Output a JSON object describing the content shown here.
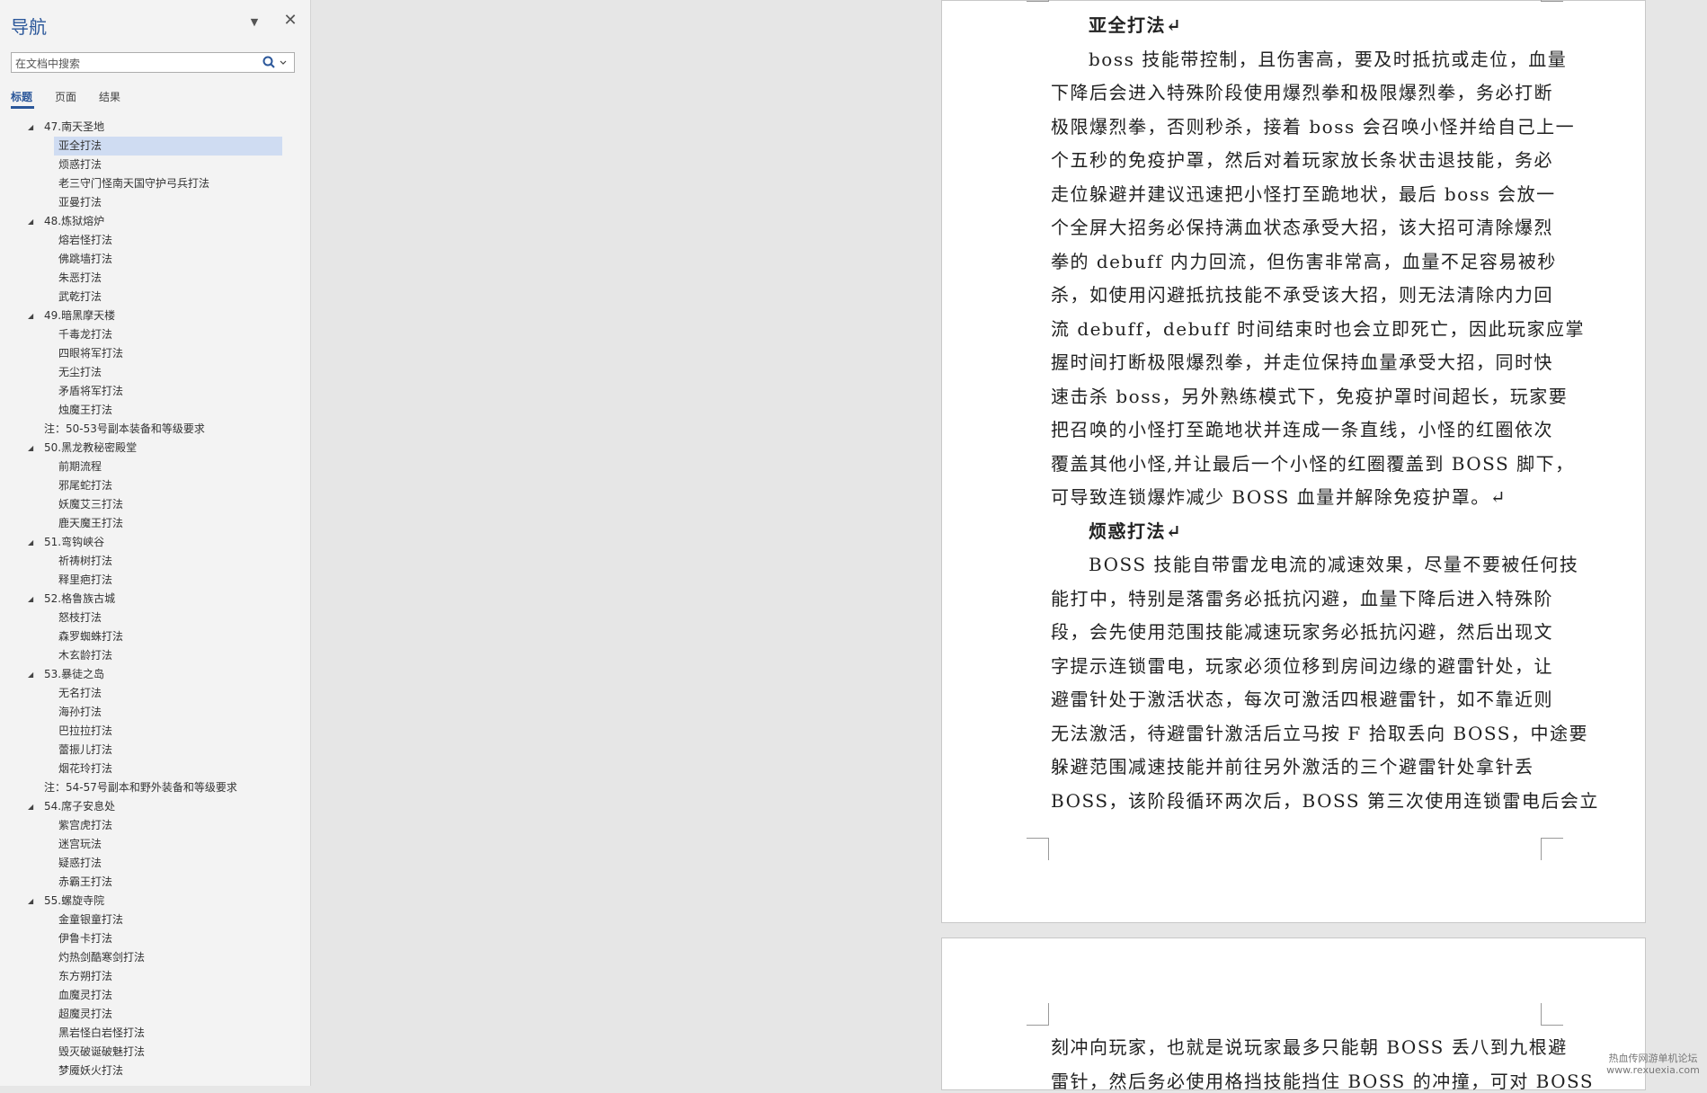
{
  "nav": {
    "title": "导航",
    "search_placeholder": "在文档中搜索",
    "tabs": [
      "标题",
      "页面",
      "结果"
    ],
    "items": [
      {
        "level": 1,
        "label": "47.南天圣地",
        "expanded": true
      },
      {
        "level": 2,
        "label": "亚全打法",
        "selected": true
      },
      {
        "level": 2,
        "label": "烦惑打法"
      },
      {
        "level": 2,
        "label": "老三守门怪南天国守护弓兵打法"
      },
      {
        "level": 2,
        "label": "亚曼打法"
      },
      {
        "level": 1,
        "label": "48.炼狱熔炉",
        "expanded": true
      },
      {
        "level": 2,
        "label": "熔岩怪打法"
      },
      {
        "level": 2,
        "label": "佛跳墙打法"
      },
      {
        "level": 2,
        "label": "朱恶打法"
      },
      {
        "level": 2,
        "label": "武乾打法"
      },
      {
        "level": 1,
        "label": "49.暗黑摩天楼",
        "expanded": true
      },
      {
        "level": 2,
        "label": "千毒龙打法"
      },
      {
        "level": 2,
        "label": "四眼将军打法"
      },
      {
        "level": 2,
        "label": "无尘打法"
      },
      {
        "level": 2,
        "label": "矛盾将军打法"
      },
      {
        "level": 2,
        "label": "烛魔王打法"
      },
      {
        "level": 1,
        "label": "注：50-53号副本装备和等级要求"
      },
      {
        "level": 1,
        "label": "50.黑龙教秘密殿堂",
        "expanded": true
      },
      {
        "level": 2,
        "label": "前期流程"
      },
      {
        "level": 2,
        "label": "邪尾蛇打法"
      },
      {
        "level": 2,
        "label": "妖魔艾三打法"
      },
      {
        "level": 2,
        "label": "鹿天魔王打法"
      },
      {
        "level": 1,
        "label": "51.弯钩峡谷",
        "expanded": true
      },
      {
        "level": 2,
        "label": "祈祷树打法"
      },
      {
        "level": 2,
        "label": "释里疤打法"
      },
      {
        "level": 1,
        "label": "52.格鲁族古城",
        "expanded": true
      },
      {
        "level": 2,
        "label": "怒枝打法"
      },
      {
        "level": 2,
        "label": "森罗蜘蛛打法"
      },
      {
        "level": 2,
        "label": "木玄龄打法"
      },
      {
        "level": 1,
        "label": "53.暴徒之岛",
        "expanded": true
      },
      {
        "level": 2,
        "label": "无名打法"
      },
      {
        "level": 2,
        "label": "海孙打法"
      },
      {
        "level": 2,
        "label": "巴拉拉打法"
      },
      {
        "level": 2,
        "label": "蕾振儿打法"
      },
      {
        "level": 2,
        "label": "烟花玲打法"
      },
      {
        "level": 1,
        "label": "注：54-57号副本和野外装备和等级要求"
      },
      {
        "level": 1,
        "label": "54.席子安息处",
        "expanded": true
      },
      {
        "level": 2,
        "label": "紫宫虎打法"
      },
      {
        "level": 2,
        "label": "迷宫玩法"
      },
      {
        "level": 2,
        "label": "疑惑打法"
      },
      {
        "level": 2,
        "label": "赤霸王打法"
      },
      {
        "level": 1,
        "label": "55.螺旋寺院",
        "expanded": true
      },
      {
        "level": 2,
        "label": "金童银童打法"
      },
      {
        "level": 2,
        "label": "伊鲁卡打法"
      },
      {
        "level": 2,
        "label": "灼热剑酷寒剑打法"
      },
      {
        "level": 2,
        "label": "东方朔打法"
      },
      {
        "level": 2,
        "label": "血魔灵打法"
      },
      {
        "level": 2,
        "label": "超魔灵打法"
      },
      {
        "level": 2,
        "label": "黑岩怪白岩怪打法"
      },
      {
        "level": 2,
        "label": "毁灭破诞破魅打法"
      },
      {
        "level": 2,
        "label": "梦魇妖火打法"
      }
    ]
  },
  "document": {
    "lines": [
      {
        "text": "亚全打法↵",
        "heading": true,
        "indent": true
      },
      {
        "text": "boss 技能带控制，且伤害高，要及时抵抗或走位，血量",
        "indent": true
      },
      {
        "text": "下降后会进入特殊阶段使用爆烈拳和极限爆烈拳，务必打断"
      },
      {
        "text": "极限爆烈拳，否则秒杀，接着 boss 会召唤小怪并给自己上一"
      },
      {
        "text": "个五秒的免疫护罩，然后对着玩家放长条状击退技能，务必"
      },
      {
        "text": "走位躲避并建议迅速把小怪打至跪地状，最后 boss 会放一"
      },
      {
        "text": "个全屏大招务必保持满血状态承受大招，该大招可清除爆烈"
      },
      {
        "text": "拳的 debuff 内力回流，但伤害非常高，血量不足容易被秒"
      },
      {
        "text": "杀，如使用闪避抵抗技能不承受该大招，则无法清除内力回"
      },
      {
        "text": "流 debuff，debuff 时间结束时也会立即死亡，因此玩家应掌"
      },
      {
        "text": "握时间打断极限爆烈拳，并走位保持血量承受大招，同时快"
      },
      {
        "text": "速击杀 boss，另外熟练模式下，免疫护罩时间超长，玩家要"
      },
      {
        "text": "把召唤的小怪打至跪地状并连成一条直线，小怪的红圈依次"
      },
      {
        "text": "覆盖其他小怪,并让最后一个小怪的红圈覆盖到 BOSS 脚下，"
      },
      {
        "text": "可导致连锁爆炸减少 BOSS 血量并解除免疫护罩。↵"
      },
      {
        "text": "烦惑打法↵",
        "heading": true,
        "indent": true
      },
      {
        "text": "BOSS 技能自带雷龙电流的减速效果，尽量不要被任何技",
        "indent": true
      },
      {
        "text": "能打中，特别是落雷务必抵抗闪避，血量下降后进入特殊阶"
      },
      {
        "text": "段，会先使用范围技能减速玩家务必抵抗闪避，然后出现文"
      },
      {
        "text": "字提示连锁雷电，玩家必须位移到房间边缘的避雷针处，让"
      },
      {
        "text": "避雷针处于激活状态，每次可激活四根避雷针，如不靠近则"
      },
      {
        "text": "无法激活，待避雷针激活后立马按 F 拾取丢向 BOSS，中途要"
      },
      {
        "text": "躲避范围减速技能并前往另外激活的三个避雷针处拿针丢"
      },
      {
        "text": "BOSS，该阶段循环两次后，BOSS 第三次使用连锁雷电后会立"
      }
    ],
    "page2_lines": [
      {
        "text": "刻冲向玩家，也就是说玩家最多只能朝 BOSS 丢八到九根避"
      },
      {
        "text": "雷针，然后务必使用格挡技能挡住 BOSS 的冲撞，可对 BOSS"
      }
    ]
  },
  "watermark": {
    "line1": "热血传网游单机论坛",
    "line2": "www.rexuexia.com"
  }
}
